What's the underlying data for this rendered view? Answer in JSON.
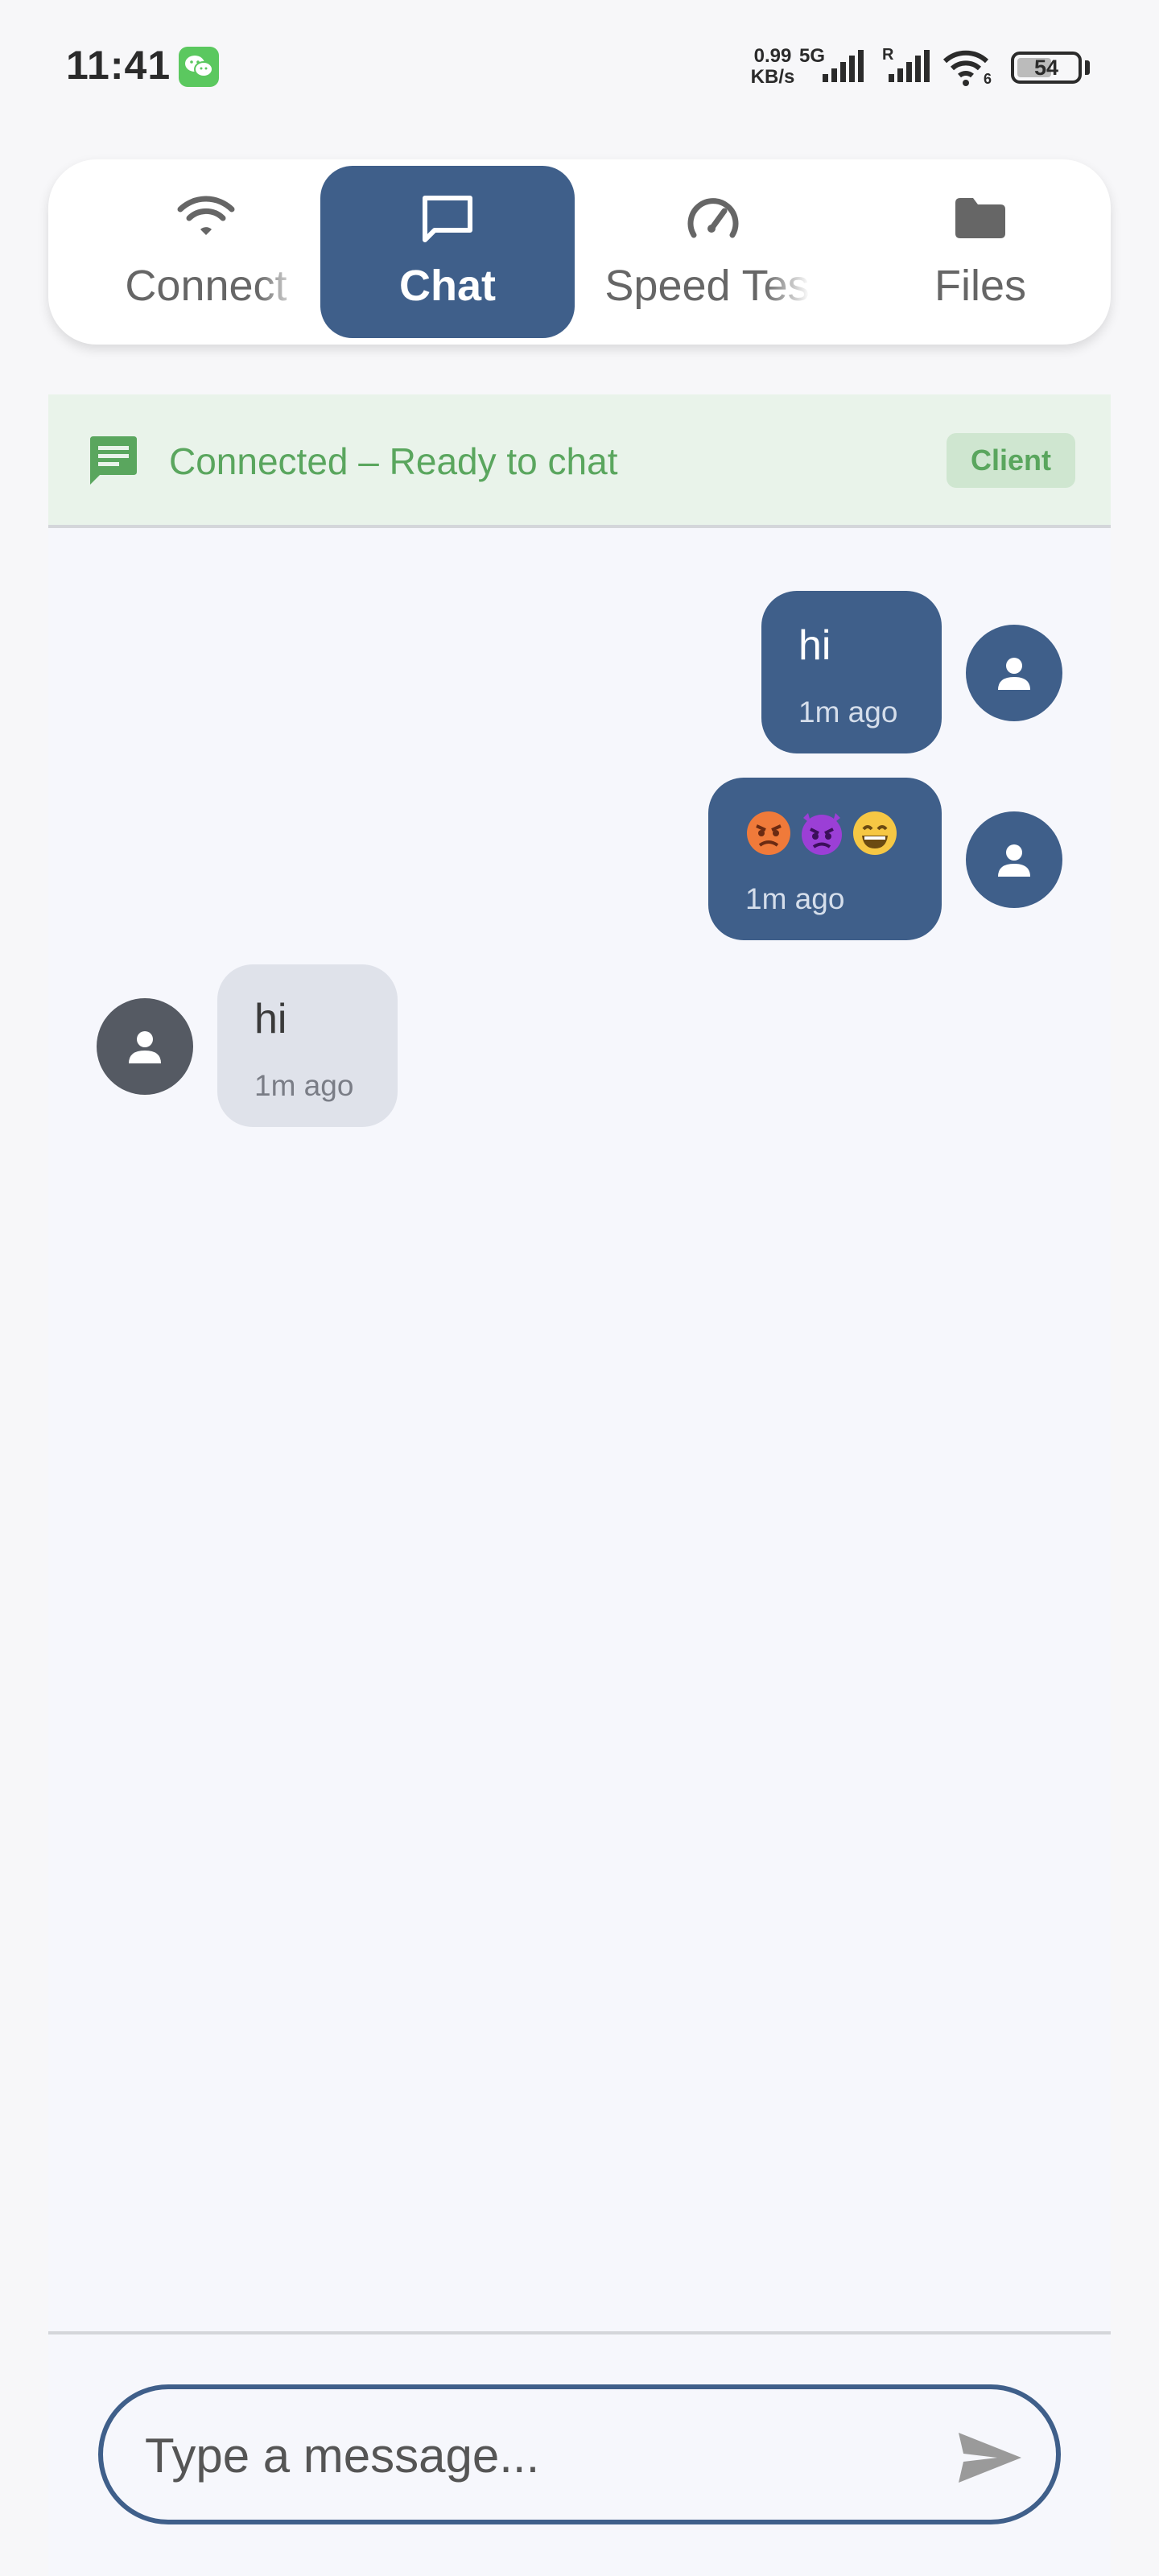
{
  "status_bar": {
    "time": "11:41",
    "net_speed_value": "0.99",
    "net_speed_unit": "KB/s",
    "network_type": "5G",
    "roaming": "R",
    "wifi_badge": "6",
    "battery": "54"
  },
  "tabs": [
    {
      "label": "Connect",
      "icon": "wifi-icon",
      "active": false
    },
    {
      "label": "Chat",
      "icon": "chat-bubble-icon",
      "active": true
    },
    {
      "label": "Speed Test",
      "icon": "speedometer-icon",
      "active": false
    },
    {
      "label": "Files",
      "icon": "folder-icon",
      "active": false
    }
  ],
  "connection": {
    "status": "Connected – Ready to chat",
    "role": "Client",
    "icon": "message-icon"
  },
  "messages": [
    {
      "direction": "sent",
      "text": "hi",
      "time": "1m ago"
    },
    {
      "direction": "sent",
      "text": "😡👿😄",
      "time": "1m ago",
      "emojis": [
        "😡",
        "👿",
        "😄"
      ]
    },
    {
      "direction": "received",
      "text": "hi",
      "time": "1m ago"
    }
  ],
  "composer": {
    "placeholder": "Type a message...",
    "value": ""
  },
  "colors": {
    "accent": "#3f5f8a",
    "success": "#5aa65e",
    "banner_bg": "#e9f3ea",
    "received_bubble": "#dfe2ea",
    "received_avatar": "#555a63"
  }
}
